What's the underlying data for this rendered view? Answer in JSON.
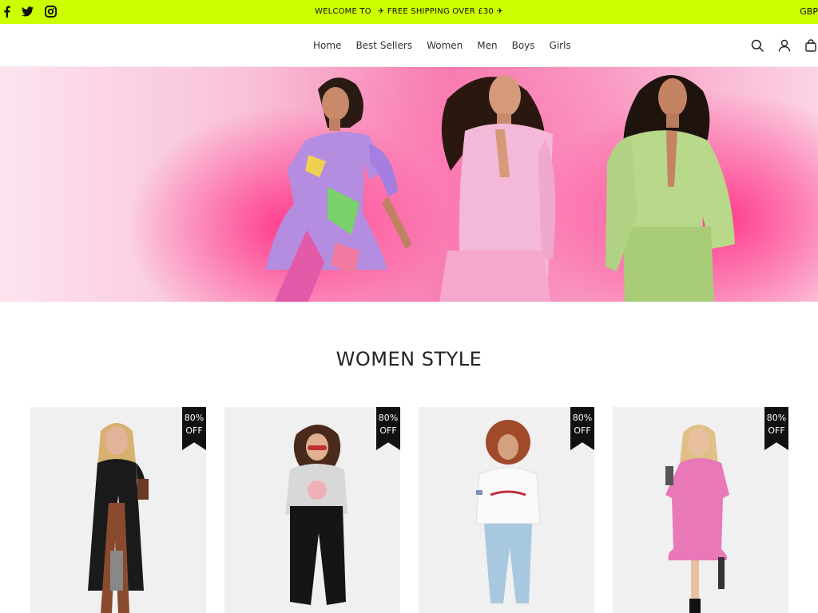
{
  "announcement": {
    "welcome": "WELCOME TO",
    "shipping": "✈ FREE SHIPPING OVER £30 ✈"
  },
  "currency": "GBP",
  "social": [
    "facebook-icon",
    "twitter-icon",
    "instagram-icon"
  ],
  "nav": {
    "items": [
      {
        "label": "Home"
      },
      {
        "label": "Best Sellers"
      },
      {
        "label": "Women"
      },
      {
        "label": "Men"
      },
      {
        "label": "Boys"
      },
      {
        "label": "Girls"
      }
    ]
  },
  "header_icons": [
    "search-icon",
    "account-icon",
    "cart-icon"
  ],
  "section": {
    "title": "WOMEN STYLE"
  },
  "products": [
    {
      "badge_line1": "80%",
      "badge_line2": "OFF"
    },
    {
      "badge_line1": "80%",
      "badge_line2": "OFF"
    },
    {
      "badge_line1": "80%",
      "badge_line2": "OFF"
    },
    {
      "badge_line1": "80%",
      "badge_line2": "OFF"
    }
  ],
  "colors": {
    "announcement_bg": "#ccff00",
    "badge_bg": "#111111",
    "hero_pink": "#ff3d8e"
  }
}
